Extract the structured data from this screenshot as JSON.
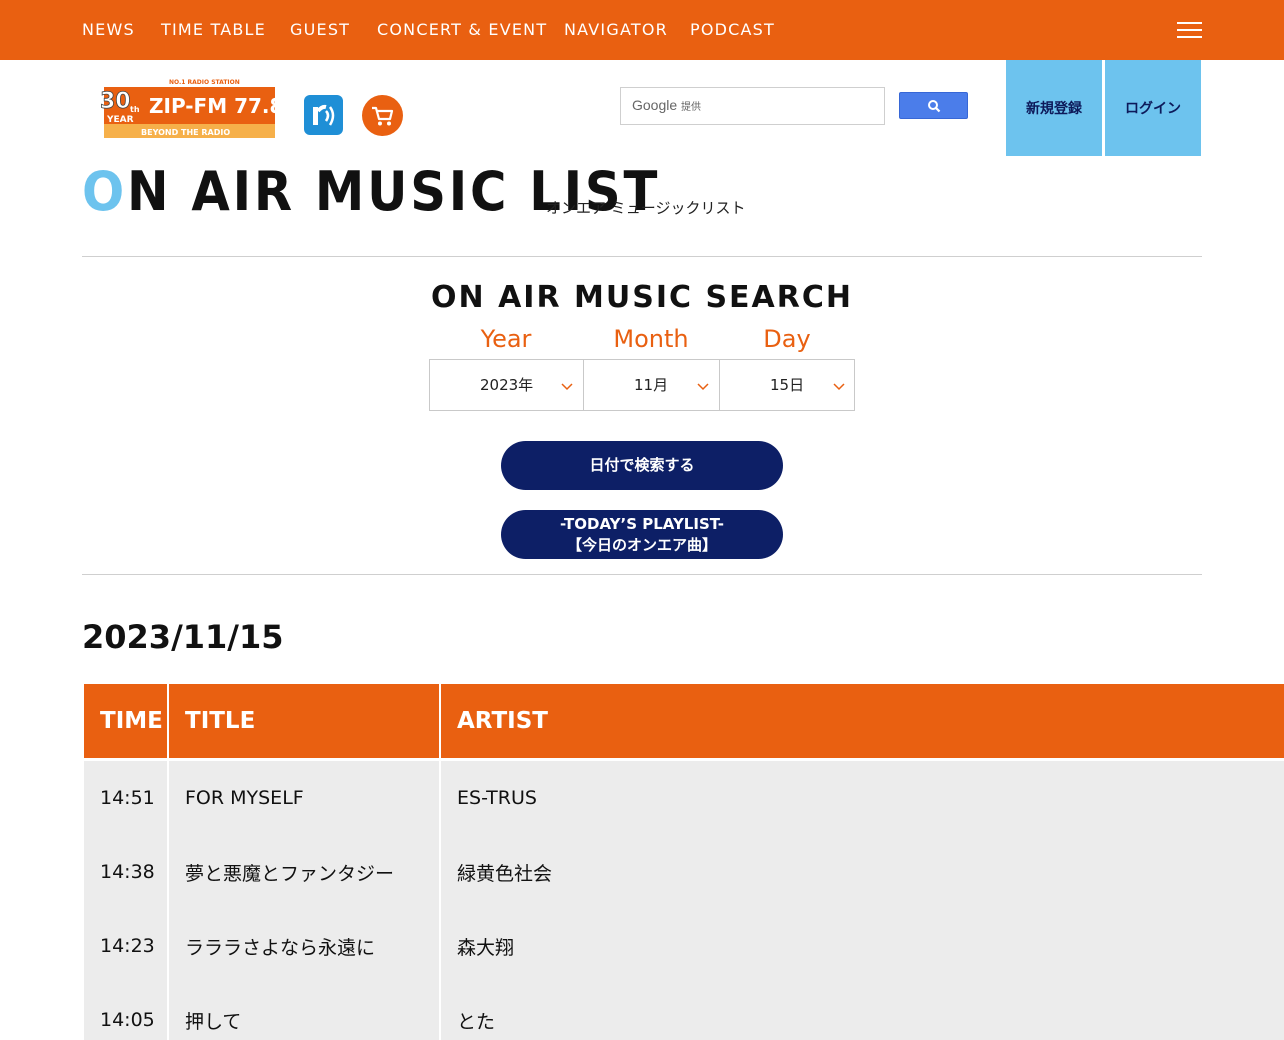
{
  "nav": {
    "items": [
      "NEWS",
      "TIME TABLE",
      "GUEST",
      "CONCERT & EVENT",
      "NAVIGATOR",
      "PODCAST"
    ]
  },
  "logo": {
    "top": "NO.1 RADIO STATION",
    "anniv_num": "30",
    "anniv_suffix": "th",
    "anniv_word": "YEAR",
    "name": "ZIP-FM 77.8",
    "tagline": "BEYOND THE RADIO"
  },
  "header": {
    "search_brand": "Google",
    "search_brand_suffix": "提供",
    "register_label": "新規登録",
    "login_label": "ログイン"
  },
  "page": {
    "title_first": "O",
    "title_rest": "N AIR MUSIC LIST",
    "subtitle": "オンエア ミュージックリスト"
  },
  "search": {
    "heading": "ON AIR MUSIC SEARCH",
    "year_label": "Year",
    "month_label": "Month",
    "day_label": "Day",
    "year_value": "2023年",
    "month_value": "11月",
    "day_value": "15日",
    "search_button": "日付で検索する",
    "today_line1": "-TODAY’S PLAYLIST-",
    "today_line2": "【今日のオンエア曲】"
  },
  "results": {
    "date": "2023/11/15",
    "columns": [
      "TIME",
      "TITLE",
      "ARTIST"
    ],
    "rows": [
      {
        "time": "14:51",
        "title": "FOR MYSELF",
        "artist": "ES-TRUS"
      },
      {
        "time": "14:38",
        "title": "夢と悪魔とファンタジー",
        "artist": "緑黄色社会"
      },
      {
        "time": "14:23",
        "title": "ラララさよなら永遠に",
        "artist": "森大翔"
      },
      {
        "time": "14:05",
        "title": "押して",
        "artist": "とた"
      }
    ]
  },
  "colors": {
    "accent": "#e96011",
    "sky": "#6dc3ee",
    "navy": "#0d1f66",
    "row_bg": "#ececec"
  }
}
